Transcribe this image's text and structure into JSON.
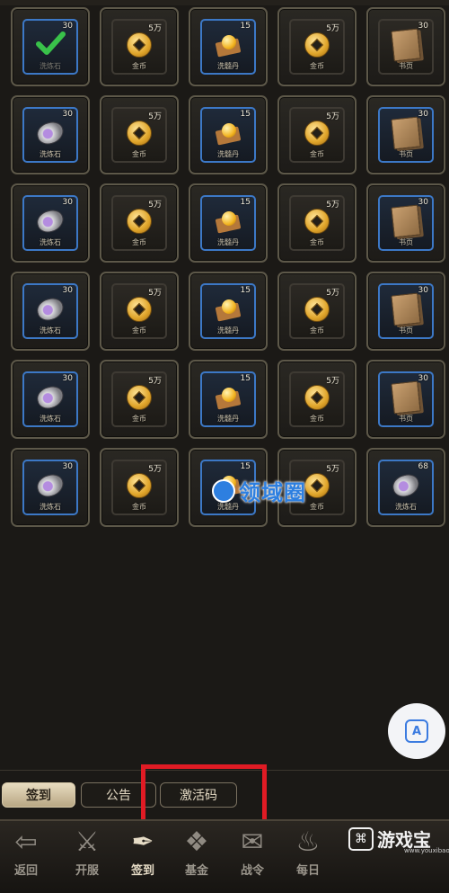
{
  "rewards": {
    "rows": [
      [
        {
          "name": "洗炼石",
          "qty": "30",
          "kind": "check",
          "frame": "blue",
          "claimed": true
        },
        {
          "name": "金币",
          "qty": "5万",
          "kind": "coin",
          "frame": "plain"
        },
        {
          "name": "洗髓丹",
          "qty": "15",
          "kind": "pill",
          "frame": "blue"
        },
        {
          "name": "金币",
          "qty": "5万",
          "kind": "coin",
          "frame": "plain"
        },
        {
          "name": "书页",
          "qty": "30",
          "kind": "book",
          "frame": "plain"
        }
      ],
      [
        {
          "name": "洗炼石",
          "qty": "30",
          "kind": "stone",
          "frame": "blue"
        },
        {
          "name": "金币",
          "qty": "5万",
          "kind": "coin",
          "frame": "plain"
        },
        {
          "name": "洗髓丹",
          "qty": "15",
          "kind": "pill",
          "frame": "blue"
        },
        {
          "name": "金币",
          "qty": "5万",
          "kind": "coin",
          "frame": "plain"
        },
        {
          "name": "书页",
          "qty": "30",
          "kind": "book",
          "frame": "blue"
        }
      ],
      [
        {
          "name": "洗炼石",
          "qty": "30",
          "kind": "stone",
          "frame": "blue"
        },
        {
          "name": "金币",
          "qty": "5万",
          "kind": "coin",
          "frame": "plain"
        },
        {
          "name": "洗髓丹",
          "qty": "15",
          "kind": "pill",
          "frame": "blue"
        },
        {
          "name": "金币",
          "qty": "5万",
          "kind": "coin",
          "frame": "plain"
        },
        {
          "name": "书页",
          "qty": "30",
          "kind": "book",
          "frame": "blue"
        }
      ],
      [
        {
          "name": "洗炼石",
          "qty": "30",
          "kind": "stone",
          "frame": "blue"
        },
        {
          "name": "金币",
          "qty": "5万",
          "kind": "coin",
          "frame": "plain"
        },
        {
          "name": "洗髓丹",
          "qty": "15",
          "kind": "pill",
          "frame": "blue"
        },
        {
          "name": "金币",
          "qty": "5万",
          "kind": "coin",
          "frame": "plain"
        },
        {
          "name": "书页",
          "qty": "30",
          "kind": "book",
          "frame": "blue"
        }
      ],
      [
        {
          "name": "洗炼石",
          "qty": "30",
          "kind": "stone",
          "frame": "blue"
        },
        {
          "name": "金币",
          "qty": "5万",
          "kind": "coin",
          "frame": "plain"
        },
        {
          "name": "洗髓丹",
          "qty": "15",
          "kind": "pill",
          "frame": "blue"
        },
        {
          "name": "金币",
          "qty": "5万",
          "kind": "coin",
          "frame": "plain"
        },
        {
          "name": "书页",
          "qty": "30",
          "kind": "book",
          "frame": "blue"
        }
      ],
      [
        {
          "name": "洗炼石",
          "qty": "30",
          "kind": "stone",
          "frame": "blue"
        },
        {
          "name": "金币",
          "qty": "5万",
          "kind": "coin",
          "frame": "plain"
        },
        {
          "name": "洗髓丹",
          "qty": "15",
          "kind": "pill",
          "frame": "blue"
        },
        {
          "name": "金币",
          "qty": "5万",
          "kind": "coin",
          "frame": "plain"
        },
        {
          "name": "洗炼石",
          "qty": "68",
          "kind": "stone",
          "frame": "blue"
        }
      ]
    ]
  },
  "watermark": {
    "text": "领域圈"
  },
  "side_button": {
    "label": "A"
  },
  "tabs": [
    {
      "label": "签到",
      "active": true
    },
    {
      "label": "公告",
      "active": false
    },
    {
      "label": "激活码",
      "active": false
    }
  ],
  "bottom_nav": {
    "back_label": "返回",
    "items": [
      {
        "label": "开服",
        "icon": "sword-icon",
        "active": false
      },
      {
        "label": "签到",
        "icon": "brush-icon",
        "active": true
      },
      {
        "label": "基金",
        "icon": "emblem-icon",
        "active": false
      },
      {
        "label": "战令",
        "icon": "scroll-icon",
        "active": false
      },
      {
        "label": "每日",
        "icon": "flame-icon",
        "active": false
      }
    ]
  },
  "brand": {
    "name": "游戏宝",
    "url": "www.youxibao.com"
  },
  "colors": {
    "accent_blue": "#3c78c6",
    "highlight_red": "#e01b24",
    "gold": "#e0a52a"
  }
}
